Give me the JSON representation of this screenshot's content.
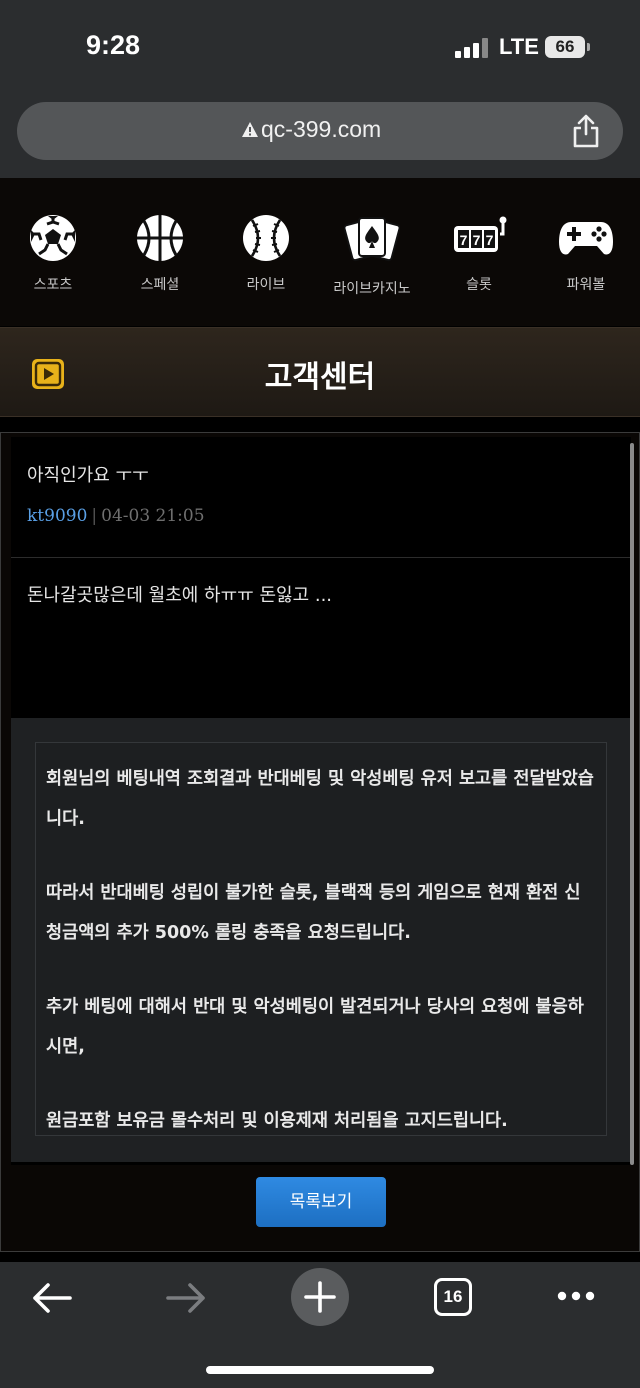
{
  "status_bar": {
    "time": "9:28",
    "network": "LTE",
    "battery": "66"
  },
  "browser": {
    "url": "qc-399.com",
    "tabs_count": "16"
  },
  "nav": {
    "items": [
      {
        "label": "스포츠",
        "icon": "soccer-ball-icon"
      },
      {
        "label": "스페셜",
        "icon": "basketball-icon"
      },
      {
        "label": "라이브",
        "icon": "baseball-icon"
      },
      {
        "label": "라이브카지노",
        "icon": "cards-icon"
      },
      {
        "label": "슬롯",
        "icon": "slot-machine-icon"
      },
      {
        "label": "파워볼",
        "icon": "gamepad-icon"
      }
    ]
  },
  "section": {
    "title": "고객센터"
  },
  "post": {
    "title": "아직인가요 ㅜㅜ",
    "author": "kt9090",
    "separator": "|",
    "date": "04-03 21:05",
    "body": "돈나갈곳많은데 월초에 하ㅠㅠ 돈잃고 ..."
  },
  "notice": {
    "paragraphs": [
      "회원님의 베팅내역 조회결과 반대베팅 및 악성베팅 유저 보고를 전달받았습니다.",
      "따라서 반대베팅 성립이 불가한 슬롯, 블랙잭 등의 게임으로 현재 환전 신청금액의 추가 500% 롤링 충족을 요청드립니다.",
      "추가 베팅에 대해서 반대 및 악성베팅이 발견되거나 당사의 요청에 불응하시면,",
      "원금포함 보유금 몰수처리 및 이용제재 처리됨을 고지드립니다."
    ]
  },
  "buttons": {
    "list": "목록보기"
  },
  "colors": {
    "accent_blue": "#2f8ae2",
    "author_link": "#5aa0e6",
    "header_gold": "#e8b21a"
  }
}
